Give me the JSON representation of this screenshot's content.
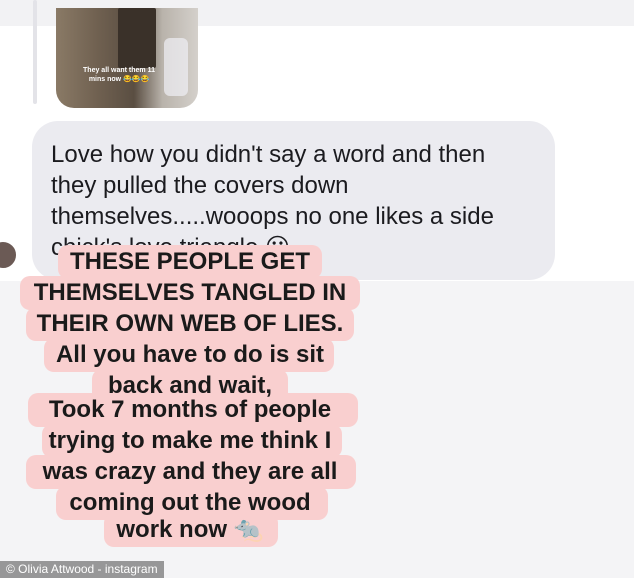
{
  "thumbnail": {
    "caption": "They all want them 11 mins now 😂😂😂"
  },
  "message": {
    "lines": [
      "Love how you didn't say a word and then",
      "they pulled the covers down",
      "themselves.....wooops no one likes a side",
      "chick's love triangle ☹"
    ]
  },
  "overlay": {
    "lines": [
      "THESE PEOPLE GET",
      "THEMSELVES TANGLED IN",
      "THEIR OWN WEB OF LIES.",
      "All you have to do is sit",
      "back and wait,",
      "Took 7 months of people",
      "trying to make me think I",
      "was crazy and they are all",
      "coming out the wood",
      "work now 🐀"
    ],
    "highlight_color": "#f9cfcf"
  },
  "credit": "© Olivia Attwood - instagram"
}
